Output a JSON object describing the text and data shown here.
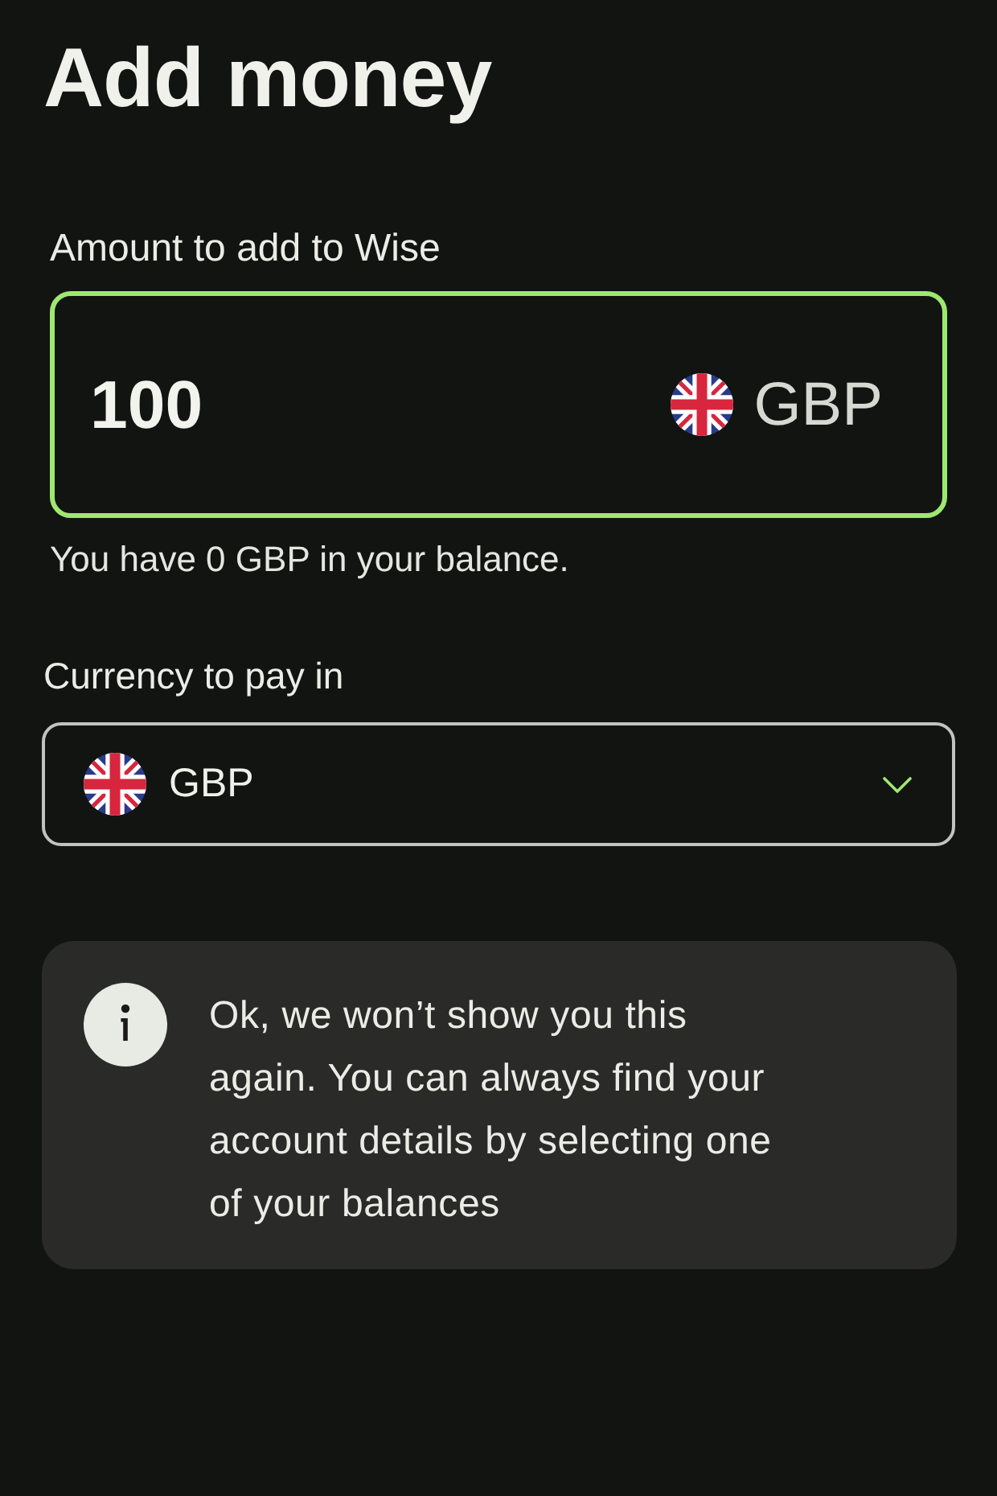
{
  "title": "Add money",
  "amount": {
    "label": "Amount to add to Wise",
    "value": "100",
    "currency": "GBP",
    "focused": true
  },
  "balance_note": "You have 0 GBP in your balance.",
  "pay_currency": {
    "label": "Currency to pay in",
    "value": "GBP"
  },
  "info": {
    "message": "Ok, we won’t show you this again. You can always find your account details by selecting one of your balances"
  }
}
